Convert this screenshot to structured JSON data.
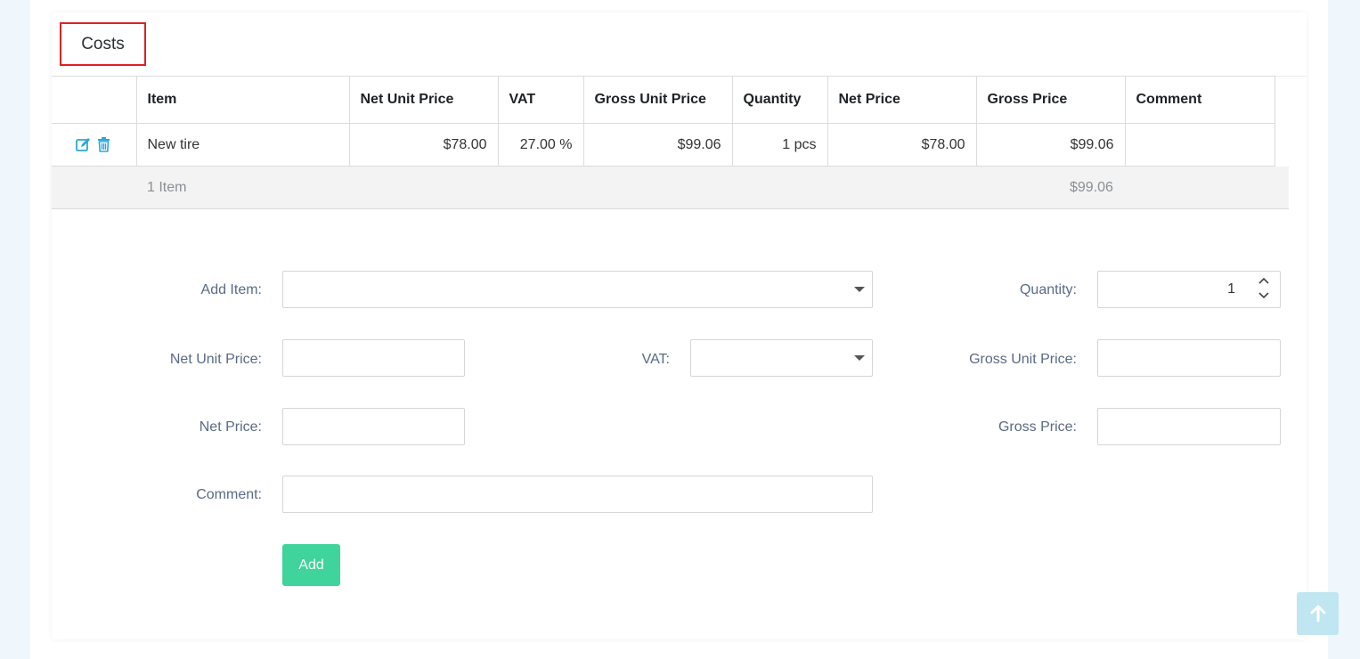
{
  "section": {
    "title": "Costs"
  },
  "table": {
    "columns": [
      "",
      "Item",
      "Net Unit Price",
      "VAT",
      "Gross Unit Price",
      "Quantity",
      "Net Price",
      "Gross Price",
      "Comment"
    ],
    "rows": [
      {
        "item": "New tire",
        "net_unit_price": "$78.00",
        "vat": "27.00 %",
        "gross_unit_price": "$99.06",
        "quantity": "1 pcs",
        "net_price": "$78.00",
        "gross_price": "$99.06",
        "comment": ""
      }
    ],
    "summary": {
      "count": "1 Item",
      "gross_total": "$99.06"
    }
  },
  "form": {
    "add_item_label": "Add Item:",
    "add_item_value": "",
    "quantity_label": "Quantity:",
    "quantity_value": "1",
    "net_unit_price_label": "Net Unit Price:",
    "vat_label": "VAT:",
    "gross_unit_price_label": "Gross Unit Price:",
    "net_price_label": "Net Price:",
    "gross_price_label": "Gross Price:",
    "comment_label": "Comment:",
    "add_button": "Add"
  },
  "colors": {
    "accent": "#3fd49c",
    "icon": "#2aa8d8",
    "highlight_border": "#e02020",
    "scroll_button": "#bfe6f1"
  },
  "icons": {
    "edit": "edit-icon",
    "delete": "trash-icon",
    "scroll_top": "arrow-up-icon"
  }
}
